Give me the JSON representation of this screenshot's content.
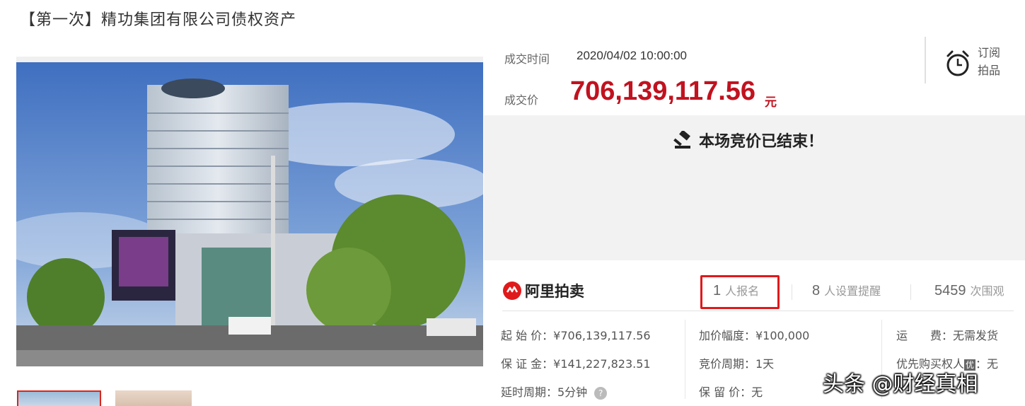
{
  "page": {
    "title": "【第一次】精功集团有限公司债权资产"
  },
  "deal": {
    "time_label": "成交时间",
    "time_value": "2020/04/02 10:00:00",
    "price_label": "成交价",
    "price_value": "706,139,117.56",
    "price_unit": "元"
  },
  "subscribe": {
    "line1": "订阅",
    "line2": "拍品",
    "icon": "alarm-clock-icon"
  },
  "status": {
    "text": "本场竞价已结束！",
    "icon": "gavel-icon"
  },
  "brand": {
    "logo_text": "阿里拍卖",
    "logo_icon": "alibaba-logo-icon",
    "color": "#e0191b"
  },
  "stats": {
    "signup_count": "1",
    "signup_label": "人报名",
    "reminder_count": "8",
    "reminder_label": "人设置提醒",
    "view_count": "5459",
    "view_label": "次围观"
  },
  "info": {
    "start_price": "起 始 价：¥706,139,117.56",
    "deposit": "保 证 金：¥141,227,823.51",
    "extension": "延时周期：5分钟",
    "increment": "加价幅度：¥100,000",
    "bid_cycle": "竞价周期：1天",
    "reserve_price": "保 留 价：无",
    "shipping": "运　　费：无需发货",
    "priority_label": "优先购买权人",
    "priority_badge": "优",
    "priority_value": "：无"
  },
  "watermark": {
    "text": "头条 @财经真相"
  },
  "colors": {
    "price": "#c1121f",
    "highlight": "#e0191b",
    "ended_bg": "#f2f2f2"
  }
}
